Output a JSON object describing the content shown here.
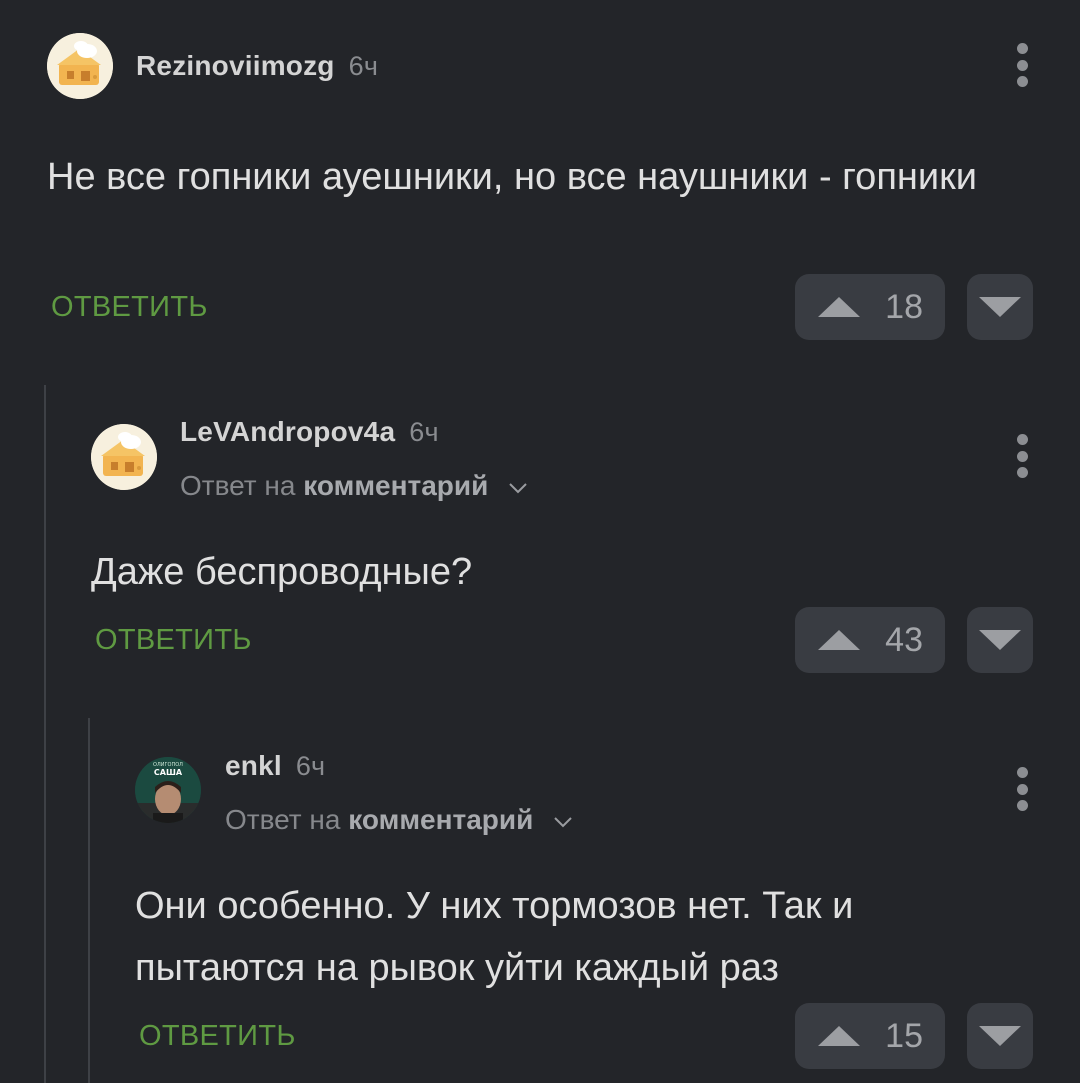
{
  "comments": [
    {
      "username": "Rezinoviimozg",
      "time": "6ч",
      "reply_prefix": "",
      "reply_target": "",
      "text": "Не все гопники ауешники, но все наушники - гопники",
      "reply_label": "ОТВЕТИТЬ",
      "rating": "18",
      "avatar_icon": "cheese-house-avatar"
    },
    {
      "username": "LeVAndropov4a",
      "time": "6ч",
      "reply_prefix": "Ответ на",
      "reply_target": "комментарий",
      "text": "Даже беспроводные?",
      "reply_label": "ОТВЕТИТЬ",
      "rating": "43",
      "avatar_icon": "cheese-house-avatar"
    },
    {
      "username": "enkl",
      "time": "6ч",
      "reply_prefix": "Ответ на",
      "reply_target": "комментарий",
      "text": "Они особенно. У них тормозов нет. Так и пытаются на рывок уйти каждый раз",
      "reply_label": "ОТВЕТИТЬ",
      "rating": "15",
      "avatar_icon": "photo-avatar",
      "avatar_caption_1": "ОЛИГОПОЛ",
      "avatar_caption_2": "САША"
    }
  ],
  "colors": {
    "background": "#232529",
    "reply_accent": "#5f9a42",
    "vote_button": "#393c42"
  }
}
